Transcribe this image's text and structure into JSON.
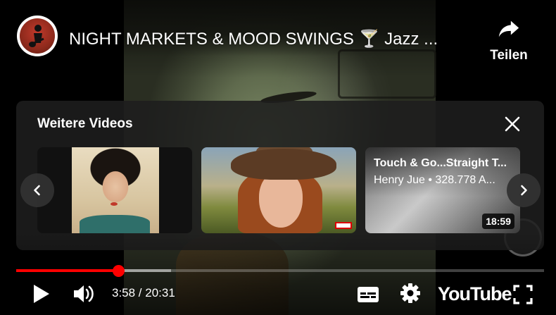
{
  "player": {
    "title": "NIGHT MARKETS & MOOD SWINGS 🍸 Jazz ...",
    "share_label": "Teilen",
    "time_display": "3:58 / 20:31",
    "progress_played_fraction": 0.193,
    "progress_buffered_fraction": 0.293,
    "brand": "YouTube",
    "accent_color": "#ff0000"
  },
  "more_videos": {
    "heading": "Weitere Videos",
    "items": [
      {
        "kind": "thumbnail-art"
      },
      {
        "kind": "thumbnail-photo"
      },
      {
        "title": "Touch & Go...Straight T...",
        "meta": "Henry Jue • 328.778 A...",
        "duration": "18:59"
      }
    ]
  },
  "icons": {
    "share": "share-icon",
    "close": "close-icon",
    "prev": "chevron-left-icon",
    "next": "chevron-right-icon",
    "play": "play-icon",
    "volume": "volume-icon",
    "subtitles": "subtitles-icon",
    "settings": "gear-icon",
    "fullscreen": "fullscreen-icon"
  }
}
